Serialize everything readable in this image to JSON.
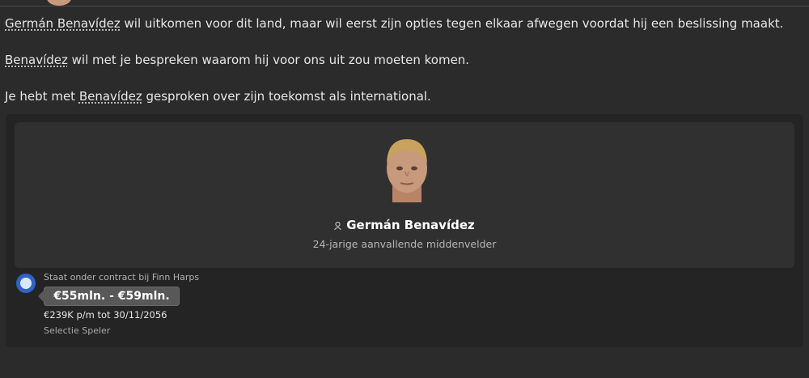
{
  "messages": [
    {
      "link": "Germán Benavídez",
      "rest": " wil uitkomen voor dit land, maar wil eerst zijn opties tegen elkaar afwegen voordat hij een beslissing maakt."
    },
    {
      "link": "Benavídez",
      "rest": " wil met je bespreken waarom hij voor ons uit zou moeten komen."
    },
    {
      "prefix": "Je hebt met ",
      "link": "Benavídez",
      "rest": " gesproken over zijn toekomst als international."
    }
  ],
  "player": {
    "name": "Germán Benavídez",
    "description": "24-jarige aanvallende middenvelder",
    "icon": "person-icon",
    "contract_status": "Staat onder contract bij Finn Harps",
    "value": "€55mln. - €59mln.",
    "wage": "€239K p/m tot 30/11/2056",
    "status": "Selectie Speler"
  },
  "colors": {
    "background": "#2b2b2b",
    "card": "#242424",
    "inner_card": "#303030",
    "club_badge": "#2f63c9"
  }
}
